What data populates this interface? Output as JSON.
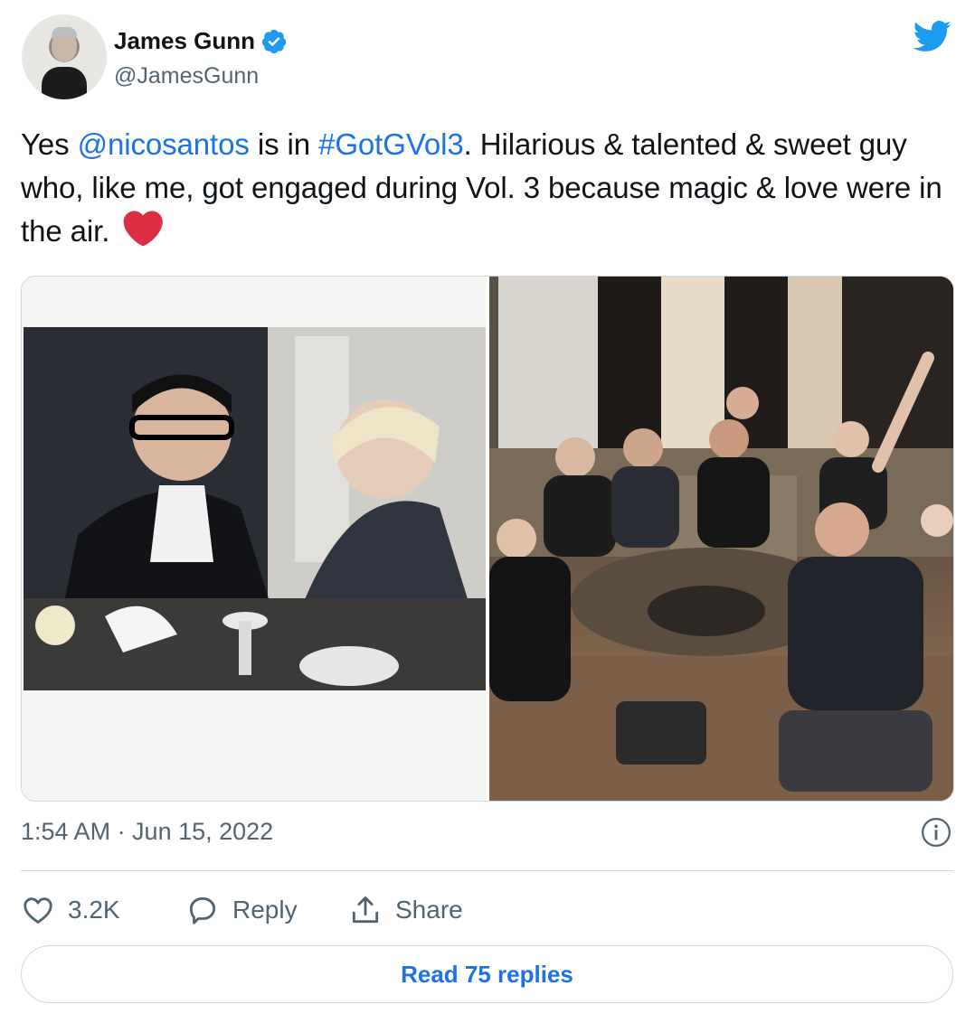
{
  "author": {
    "name": "James Gunn",
    "handle": "@JamesGunn",
    "verified": true
  },
  "tweet": {
    "text_parts": [
      {
        "text": "Yes ",
        "type": "plain"
      },
      {
        "text": "@nicosantos",
        "type": "mention"
      },
      {
        "text": " is in ",
        "type": "plain"
      },
      {
        "text": "#GotGVol3",
        "type": "hashtag"
      },
      {
        "text": ". Hilarious & talented & sweet guy who, like me, got engaged during Vol. 3 because magic & love were in the air. ",
        "type": "plain"
      }
    ],
    "emoji": "heart-emoji",
    "media_count": 2
  },
  "meta": {
    "timestamp": "1:54 AM · Jun 15, 2022"
  },
  "actions": {
    "like_count": "3.2K",
    "reply_label": "Reply",
    "share_label": "Share"
  },
  "read_replies": "Read 75 replies",
  "colors": {
    "accent": "#1a73e8",
    "twitter_blue": "#1d9bf0",
    "heart_red": "#dd2e44",
    "secondary_text": "#536471",
    "border": "#cfd9de"
  }
}
